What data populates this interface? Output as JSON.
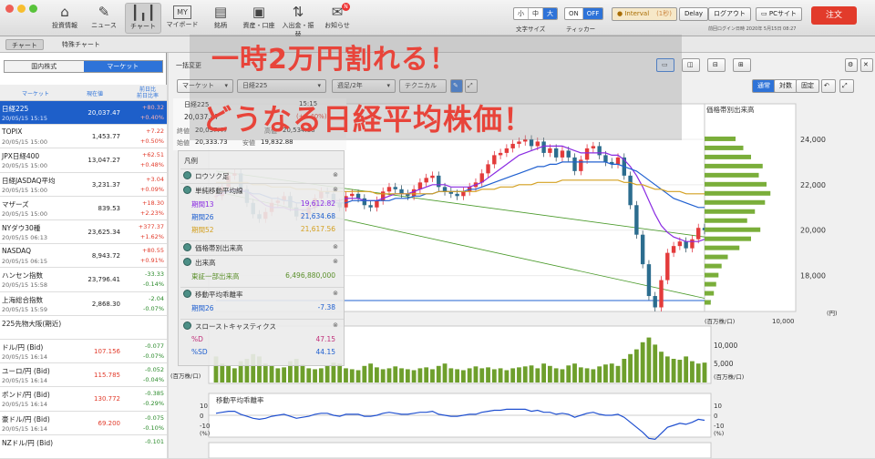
{
  "toolbar": {
    "buttons": [
      {
        "label": "投資情報",
        "icon": "home-icon"
      },
      {
        "label": "ニュース",
        "icon": "news-icon"
      },
      {
        "label": "チャート",
        "icon": "chart-icon"
      },
      {
        "label": "マイボード",
        "icon": "myboard-icon"
      },
      {
        "label": "銘柄",
        "icon": "book-icon"
      },
      {
        "label": "資産・口座",
        "icon": "wallet-icon"
      },
      {
        "label": "入出金・振替",
        "icon": "transfer-icon"
      },
      {
        "label": "お知らせ",
        "icon": "notice-icon"
      }
    ],
    "my_icon_text": "MY",
    "notice_badge": "N",
    "font_size_label": "文字サイズ",
    "font_sizes": [
      "小",
      "中",
      "大"
    ],
    "ticker_label": "ティッカー",
    "ticker_on": "ON",
    "ticker_off": "OFF",
    "interval": "Interval",
    "interval_value": "(1秒)",
    "delay": "Delay",
    "logout": "ログアウト",
    "pc_site": "PCサイト",
    "order": "注文",
    "last_login": "前回ログイン日時",
    "last_login_value": "2020年 5月15日 08:27"
  },
  "subtabs": [
    "チャート",
    "特殊チャート"
  ],
  "left": {
    "tabs": [
      "国内株式",
      "マーケット"
    ],
    "headers": [
      "マーケット",
      "現在値",
      "前日比\n前日比率"
    ],
    "rows": [
      {
        "name": "日経225",
        "date": "20/05/15 15:15",
        "price": "20,037.47",
        "chg": "+80.32",
        "pct": "+0.40%",
        "selected": true
      },
      {
        "name": "TOPIX",
        "date": "20/05/15 15:00",
        "price": "1,453.77",
        "chg": "+7.22",
        "pct": "+0.50%"
      },
      {
        "name": "JPX日経400",
        "date": "20/05/15 15:00",
        "price": "13,047.27",
        "chg": "+62.51",
        "pct": "+0.48%"
      },
      {
        "name": "日経JASDAQ平均",
        "date": "20/05/15 15:00",
        "price": "3,231.37",
        "chg": "+3.04",
        "pct": "+0.09%"
      },
      {
        "name": "マザーズ",
        "date": "20/05/15 15:00",
        "price": "839.53",
        "chg": "+18.30",
        "pct": "+2.23%"
      },
      {
        "name": "NYダウ30種",
        "date": "20/05/15 06:13",
        "price": "23,625.34",
        "chg": "+377.37",
        "pct": "+1.62%"
      },
      {
        "name": "NASDAQ",
        "date": "20/05/15 06:15",
        "price": "8,943.72",
        "chg": "+80.55",
        "pct": "+0.91%"
      },
      {
        "name": "ハンセン指数",
        "date": "20/05/15 15:58",
        "price": "23,796.41",
        "chg": "-33.33",
        "pct": "-0.14%"
      },
      {
        "name": "上海総合指数",
        "date": "20/05/15 15:59",
        "price": "2,868.30",
        "chg": "-2.04",
        "pct": "-0.07%"
      },
      {
        "name": "225先物大阪(期近)",
        "date": "",
        "price": "",
        "chg": "",
        "pct": ""
      },
      {
        "name": "ドル/円 (Bid)",
        "date": "20/05/15 16:14",
        "price": "107.156",
        "chg": "-0.077",
        "pct": "-0.07%"
      },
      {
        "name": "ユーロ/円 (Bid)",
        "date": "20/05/15 16:14",
        "price": "115.785",
        "chg": "-0.052",
        "pct": "-0.04%"
      },
      {
        "name": "ポンド/円 (Bid)",
        "date": "20/05/15 16:14",
        "price": "130.772",
        "chg": "-0.385",
        "pct": "-0.29%"
      },
      {
        "name": "豪ドル/円 (Bid)",
        "date": "20/05/15 16:14",
        "price": "69.200",
        "chg": "-0.075",
        "pct": "-0.10%"
      },
      {
        "name": "NZドル/円 (Bid)",
        "date": "",
        "price": "",
        "chg": "-0.101",
        "pct": ""
      }
    ]
  },
  "controls": {
    "display_change": "一括変更",
    "market_select": "マーケット",
    "symbol_select": "日経225",
    "period_select": "週足/2年",
    "technical": "テクニカル",
    "mode_buttons": [
      "通常",
      "対数",
      "固定"
    ]
  },
  "info": {
    "symbol": "日経225",
    "time": "15:15",
    "price": "20,037.47",
    "change": "(+0.40%)",
    "close_label": "終値",
    "close": "20,037.47",
    "high_label": "高値",
    "high": "20,534.88",
    "open_label": "始値",
    "open": "20,333.73",
    "low_label": "安値",
    "low": "19,832.88"
  },
  "legend": {
    "title": "凡例",
    "candles": "ロウソク足",
    "sma": "単純移動平均線",
    "sma_rows": [
      {
        "k": "期間13",
        "v": "19,612.82",
        "color": "#8a2be2"
      },
      {
        "k": "期間26",
        "v": "21,634.68",
        "color": "#2060d0"
      },
      {
        "k": "期間52",
        "v": "21,617.56",
        "color": "#d4a020"
      }
    ],
    "vp": "価格帯別出来高",
    "volume": "出来高",
    "volume_row": {
      "k": "東証一部出来高",
      "v": "6,496,880,000"
    },
    "deviation": "移動平均乖離率",
    "dev_row": {
      "k": "期間26",
      "v": "-7.38"
    },
    "stoch": "スローストキャスティクス",
    "stoch_rows": [
      {
        "k": "%D",
        "v": "47.15"
      },
      {
        "k": "%SD",
        "v": "44.15"
      }
    ]
  },
  "chart_data": {
    "type": "line",
    "title": "",
    "ylim": [
      16500,
      25000
    ],
    "y_ticks": [
      24000,
      22000,
      20000,
      18000
    ],
    "y_tick_labels": [
      "24,000",
      "22,000",
      "20,000",
      "18,000"
    ],
    "y_unit": "(円)",
    "volume_profile_title": "価格帯別出来高",
    "volume_profile_unit": "(百万株/口)",
    "volume_profile_ticks": [
      "10,000"
    ],
    "volume_axis_ticks": [
      "10,000",
      "5,000"
    ],
    "volume_unit": "(百万株/口)",
    "deviation_title": "移動平均乖離率",
    "deviation_ticks": [
      "10",
      "0",
      "-10"
    ],
    "deviation_unit": "(%)",
    "series": [
      {
        "name": "日経225",
        "values": [
          21500,
          21900,
          22400,
          22500,
          21800,
          21200,
          20700,
          20500,
          20800,
          21200,
          21300,
          21500,
          21000,
          20600,
          20700,
          21000,
          21400,
          21700,
          21600,
          21200,
          21000,
          21500,
          21600,
          21400,
          21100,
          21000,
          21300,
          21700,
          21900,
          21800,
          21600,
          21500,
          21800,
          22100,
          22300,
          22400,
          21900,
          21700,
          21600,
          21500,
          21700,
          21900,
          22100,
          22500,
          22900,
          23300,
          23400,
          23600,
          23800,
          23900,
          24000,
          23700,
          23900,
          23400,
          23600,
          23200,
          23500,
          23200,
          22600,
          23100,
          23600,
          23700,
          23300,
          23000,
          22900,
          23200,
          22400,
          21100,
          19800,
          18500,
          17100,
          16600,
          17800,
          19000,
          19300,
          19500,
          19200,
          19600,
          20100,
          20000
        ],
        "color": "#000000"
      },
      {
        "name": "期間13",
        "values": [
          21500,
          21600,
          21700,
          21800,
          21800,
          21700,
          21500,
          21300,
          21100,
          21000,
          21000,
          21000,
          20900,
          20900,
          20900,
          20900,
          21000,
          21100,
          21200,
          21300,
          21300,
          21400,
          21400,
          21400,
          21300,
          21300,
          21300,
          21400,
          21500,
          21600,
          21600,
          21600,
          21700,
          21800,
          21900,
          22000,
          22000,
          22000,
          21900,
          21900,
          21900,
          21900,
          22000,
          22100,
          22300,
          22500,
          22700,
          22900,
          23100,
          23300,
          23400,
          23500,
          23600,
          23700,
          23700,
          23700,
          23700,
          23600,
          23500,
          23400,
          23400,
          23400,
          23400,
          23400,
          23300,
          23300,
          23100,
          22800,
          22400,
          21900,
          21300,
          20700,
          20200,
          19900,
          19700,
          19600,
          19500,
          19500,
          19500,
          19600
        ],
        "color": "#8a2be2"
      },
      {
        "name": "期間26",
        "values": [
          21700,
          21700,
          21700,
          21700,
          21700,
          21700,
          21600,
          21600,
          21500,
          21400,
          21400,
          21300,
          21300,
          21200,
          21200,
          21200,
          21200,
          21200,
          21200,
          21200,
          21200,
          21200,
          21300,
          21300,
          21300,
          21300,
          21300,
          21300,
          21300,
          21400,
          21400,
          21400,
          21500,
          21500,
          21600,
          21600,
          21700,
          21700,
          21700,
          21700,
          21700,
          21800,
          21800,
          21900,
          22000,
          22100,
          22200,
          22300,
          22400,
          22500,
          22600,
          22700,
          22800,
          22800,
          22900,
          22900,
          23000,
          23000,
          23000,
          23000,
          23000,
          23000,
          23000,
          23000,
          22900,
          22900,
          22800,
          22700,
          22600,
          22400,
          22200,
          22000,
          21800,
          21600,
          21400,
          21300,
          21200,
          21100,
          21000,
          21000
        ],
        "color": "#2060d0"
      },
      {
        "name": "期間52",
        "values": [
          22100,
          22100,
          22100,
          22100,
          22100,
          22100,
          22000,
          22000,
          22000,
          21900,
          21900,
          21900,
          21900,
          21800,
          21800,
          21800,
          21800,
          21700,
          21700,
          21700,
          21700,
          21700,
          21700,
          21700,
          21700,
          21700,
          21600,
          21600,
          21600,
          21600,
          21600,
          21600,
          21600,
          21600,
          21600,
          21600,
          21700,
          21700,
          21700,
          21700,
          21700,
          21700,
          21700,
          21800,
          21800,
          21800,
          21900,
          21900,
          21900,
          22000,
          22000,
          22000,
          22100,
          22100,
          22100,
          22100,
          22200,
          22200,
          22200,
          22200,
          22200,
          22200,
          22200,
          22200,
          22200,
          22200,
          22100,
          22100,
          22000,
          22000,
          21900,
          21800,
          21800,
          21700,
          21700,
          21700,
          21600,
          21600,
          21600,
          21600
        ],
        "color": "#d4a020"
      }
    ],
    "volume": [
      55,
      40,
      35,
      30,
      45,
      50,
      60,
      55,
      40,
      35,
      30,
      32,
      45,
      50,
      38,
      30,
      28,
      30,
      35,
      42,
      40,
      30,
      28,
      26,
      35,
      40,
      32,
      28,
      30,
      34,
      30,
      28,
      26,
      30,
      32,
      28,
      35,
      40,
      30,
      28,
      26,
      30,
      34,
      30,
      32,
      28,
      30,
      26,
      30,
      32,
      34,
      36,
      30,
      40,
      35,
      30,
      28,
      36,
      40,
      32,
      30,
      28,
      34,
      38,
      40,
      35,
      50,
      60,
      70,
      85,
      95,
      80,
      65,
      55,
      50,
      48,
      55,
      45,
      40,
      42
    ],
    "deviation": [
      2,
      3,
      4,
      4,
      1,
      -1,
      -3,
      -4,
      -3,
      -1,
      0,
      1,
      -1,
      -3,
      -2,
      -1,
      1,
      2,
      2,
      0,
      -1,
      1,
      1,
      1,
      -1,
      -1,
      0,
      2,
      3,
      2,
      1,
      1,
      2,
      3,
      3,
      4,
      1,
      0,
      -1,
      -1,
      0,
      1,
      1,
      3,
      4,
      5,
      5,
      6,
      6,
      6,
      6,
      4,
      5,
      3,
      3,
      1,
      2,
      1,
      -2,
      0,
      2,
      3,
      1,
      0,
      0,
      1,
      -2,
      -7,
      -12,
      -17,
      -23,
      -24,
      -18,
      -12,
      -10,
      -8,
      -9,
      -7,
      -4,
      -5
    ],
    "volume_profile": [
      [
        24000,
        40
      ],
      [
        23600,
        50
      ],
      [
        23200,
        60
      ],
      [
        22800,
        75
      ],
      [
        22400,
        70
      ],
      [
        22000,
        80
      ],
      [
        21600,
        85
      ],
      [
        21200,
        78
      ],
      [
        20800,
        65
      ],
      [
        20400,
        55
      ],
      [
        20000,
        72
      ],
      [
        19600,
        60
      ],
      [
        19200,
        45
      ],
      [
        18800,
        30
      ],
      [
        18400,
        22
      ],
      [
        18000,
        18
      ],
      [
        17600,
        15
      ],
      [
        17200,
        12
      ],
      [
        16800,
        8
      ]
    ]
  },
  "headline": {
    "line1": "一時2万円割れる！",
    "line2": "どうなる日経平均株価！"
  }
}
